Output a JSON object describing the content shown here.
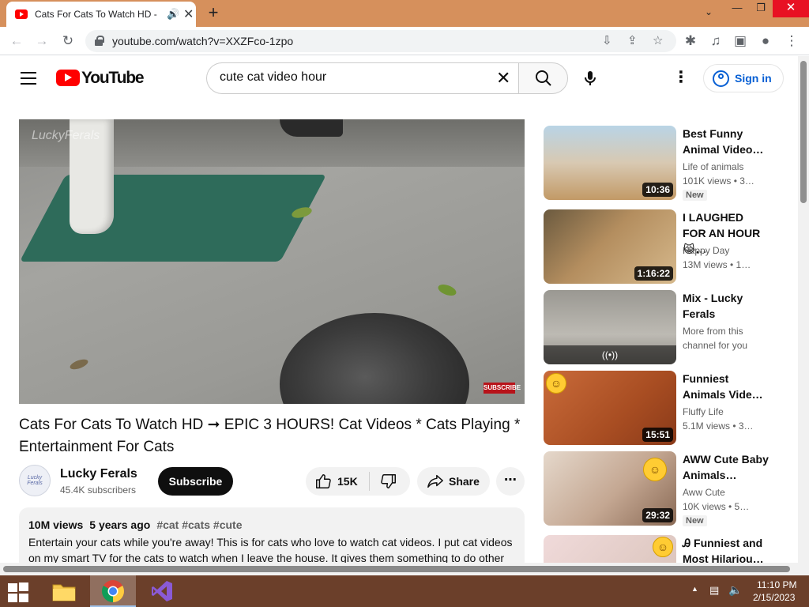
{
  "browser": {
    "tab_title": "Cats For Cats To Watch HD -",
    "url": "youtube.com/watch?v=XXZFco-1zpo"
  },
  "masthead": {
    "wordmark": "YouTube",
    "search_value": "cute cat video hour",
    "signin_label": "Sign in"
  },
  "player": {
    "watermark": "LuckyFerals",
    "subscribe_badge": "SUBSCRIBE"
  },
  "video": {
    "title": "Cats For Cats To Watch HD ➞ EPIC 3 HOURS! Cat Videos * Cats Playing * Entertainment For Cats",
    "channel_name": "Lucky Ferals",
    "channel_avatar_text": "Lucky Ferals",
    "subscribers": "45.4K subscribers",
    "subscribe_label": "Subscribe",
    "likes": "15K",
    "share_label": "Share",
    "views": "10M views",
    "age": "5 years ago",
    "hashtags": "#cat #cats #cute",
    "description": "Entertain your cats while you're away! This is for cats who love to watch cat videos. I put cat videos on my smart TV for the cats to watch when I leave the house. It gives them something to do other"
  },
  "recommendations": [
    {
      "title": "Best Funny Animal Video…",
      "channel": "Life of animals",
      "meta": "101K views  • 3…",
      "duration": "10:36",
      "badge": "New"
    },
    {
      "title": "I LAUGHED FOR AN HOUR😹…",
      "channel": "Happy Day",
      "meta": "13M views  • 1…",
      "duration": "1:16:22",
      "badge": ""
    },
    {
      "title": "Mix - Lucky Ferals",
      "channel": "More from this",
      "meta": "channel for you",
      "duration": "",
      "badge": ""
    },
    {
      "title": "Funniest Animals Vide…",
      "channel": "Fluffy Life",
      "meta": "5.1M views  • 3…",
      "duration": "15:51",
      "badge": ""
    },
    {
      "title": "AWW Cute Baby Animals…",
      "channel": "Aww Cute",
      "meta": "10K views  • 5…",
      "duration": "29:32",
      "badge": "New"
    },
    {
      "title": "Ꭿ Funniest and Most Hilariou…",
      "channel": "",
      "meta": "",
      "duration": "",
      "badge": ""
    }
  ],
  "taskbar": {
    "time": "11:10 PM",
    "date": "2/15/2023"
  },
  "colors": {
    "titlebar": "#d6905c",
    "youtube_red": "#ff0000",
    "link_blue": "#065fd4",
    "taskbar": "#6b3f2a"
  }
}
